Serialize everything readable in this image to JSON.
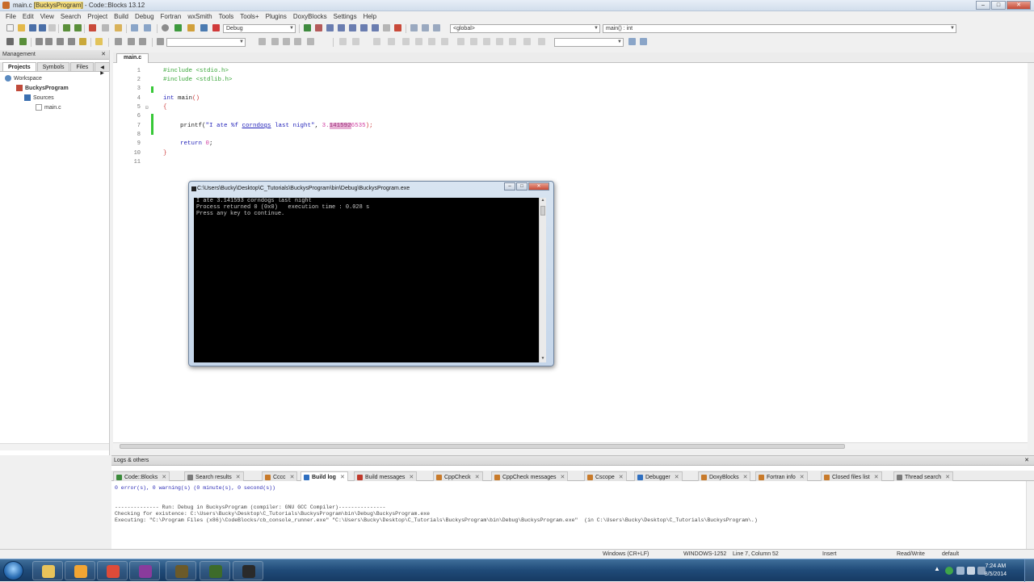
{
  "window": {
    "title_pre": "main.c ",
    "title_highlight": "[BuckysProgram]",
    "title_post": " - Code::Blocks 13.12",
    "min": "–",
    "max": "□",
    "close": "✕"
  },
  "menu": [
    "File",
    "Edit",
    "View",
    "Search",
    "Project",
    "Build",
    "Debug",
    "Fortran",
    "wxSmith",
    "Tools",
    "Tools+",
    "Plugins",
    "DoxyBlocks",
    "Settings",
    "Help"
  ],
  "toolbar": {
    "build_target": "Debug",
    "scope": "<global>",
    "function": "main() : int",
    "search": ""
  },
  "management": {
    "title": "Management",
    "close": "✕",
    "tabs": [
      "Projects",
      "Symbols",
      "Files"
    ],
    "tab_arrows": "◀ ▶",
    "tree": {
      "workspace": "Workspace",
      "project": "BuckysProgram",
      "sources": "Sources",
      "file": "main.c"
    }
  },
  "editor": {
    "tab": "main.c",
    "line_numbers": [
      "1",
      "2",
      "3",
      "4",
      "5",
      "6",
      "7",
      "8",
      "9",
      "10",
      "11"
    ],
    "code": {
      "l1": "#include <stdio.h>",
      "l2": "#include <stdlib.h>",
      "l4_kw": "int",
      "l4_rest": " main",
      "l4_paren": "()",
      "l5": "{",
      "l7_fn": "printf(",
      "l7_str1": "\"I ate %f ",
      "l7_und": "corndogs",
      "l7_str2": " last night\"",
      "l7_comma": ", ",
      "l7_num1": "3.",
      "l7_sel": "141592",
      "l7_num2": "6535",
      "l7_end": ");",
      "l9_kw": "return",
      "l9_num": " 0",
      "l9_end": ";",
      "l10": "}"
    }
  },
  "console": {
    "title": "C:\\Users\\Bucky\\Desktop\\C_Tutorials\\BuckysProgram\\bin\\Debug\\BuckysProgram.exe",
    "lines": [
      "I ate 3.141593 corndogs last night",
      "Process returned 0 (0x0)   execution time : 0.028 s",
      "Press any key to continue."
    ],
    "buttons": {
      "min": "–",
      "max": "□",
      "close": "✕"
    }
  },
  "logs": {
    "title": "Logs & others",
    "close": "✕",
    "tabs": [
      {
        "label": "Code::Blocks",
        "color": "#3a8a3a"
      },
      {
        "label": "Search results",
        "color": "#7a7a7a"
      },
      {
        "label": "Cccc",
        "color": "#c87a2a"
      },
      {
        "label": "Build log",
        "color": "#2f6fc0"
      },
      {
        "label": "Build messages",
        "color": "#c0392b"
      },
      {
        "label": "CppCheck",
        "color": "#c87a2a"
      },
      {
        "label": "CppCheck messages",
        "color": "#c87a2a"
      },
      {
        "label": "Cscope",
        "color": "#c87a2a"
      },
      {
        "label": "Debugger",
        "color": "#2f6fc0"
      },
      {
        "label": "DoxyBlocks",
        "color": "#c87a2a"
      },
      {
        "label": "Fortran info",
        "color": "#c87a2a"
      },
      {
        "label": "Closed files list",
        "color": "#c87a2a"
      },
      {
        "label": "Thread search",
        "color": "#7a7a7a"
      }
    ],
    "tab_close": "✕",
    "lines": [
      "0 error(s), 0 warning(s) (0 minute(s), 0 second(s))",
      "",
      "",
      "-------------- Run: Debug in BuckysProgram (compiler: GNU GCC Compiler)---------------",
      "Checking for existence: C:\\Users\\Bucky\\Desktop\\C_Tutorials\\BuckysProgram\\bin\\Debug\\BuckysProgram.exe",
      "Executing: \"C:\\Program Files (x86)\\CodeBlocks/cb_console_runner.exe\" \"C:\\Users\\Bucky\\Desktop\\C_Tutorials\\BuckysProgram\\bin\\Debug\\BuckysProgram.exe\"  (in C:\\Users\\Bucky\\Desktop\\C_Tutorials\\BuckysProgram\\.)"
    ]
  },
  "statusbar": {
    "eol": "Windows (CR+LF)",
    "encoding": "WINDOWS-1252",
    "position": "Line 7, Column 52",
    "mode": "Insert",
    "access": "Read/Write",
    "profile": "default"
  },
  "taskbar": {
    "time": "7:24 AM",
    "date": "8/5/2014",
    "tray_arrow": "▲",
    "apps": [
      {
        "name": "explorer",
        "color": "#e8c35a"
      },
      {
        "name": "media",
        "color": "#f2a533"
      },
      {
        "name": "chrome",
        "color": "#dd4b39"
      },
      {
        "name": "winrar",
        "color": "#8a3b9c"
      },
      {
        "name": "codeblocks",
        "color": "#6b5a2a"
      },
      {
        "name": "putty",
        "color": "#3d6b2a"
      },
      {
        "name": "terminal",
        "color": "#2a2a2a"
      }
    ]
  }
}
